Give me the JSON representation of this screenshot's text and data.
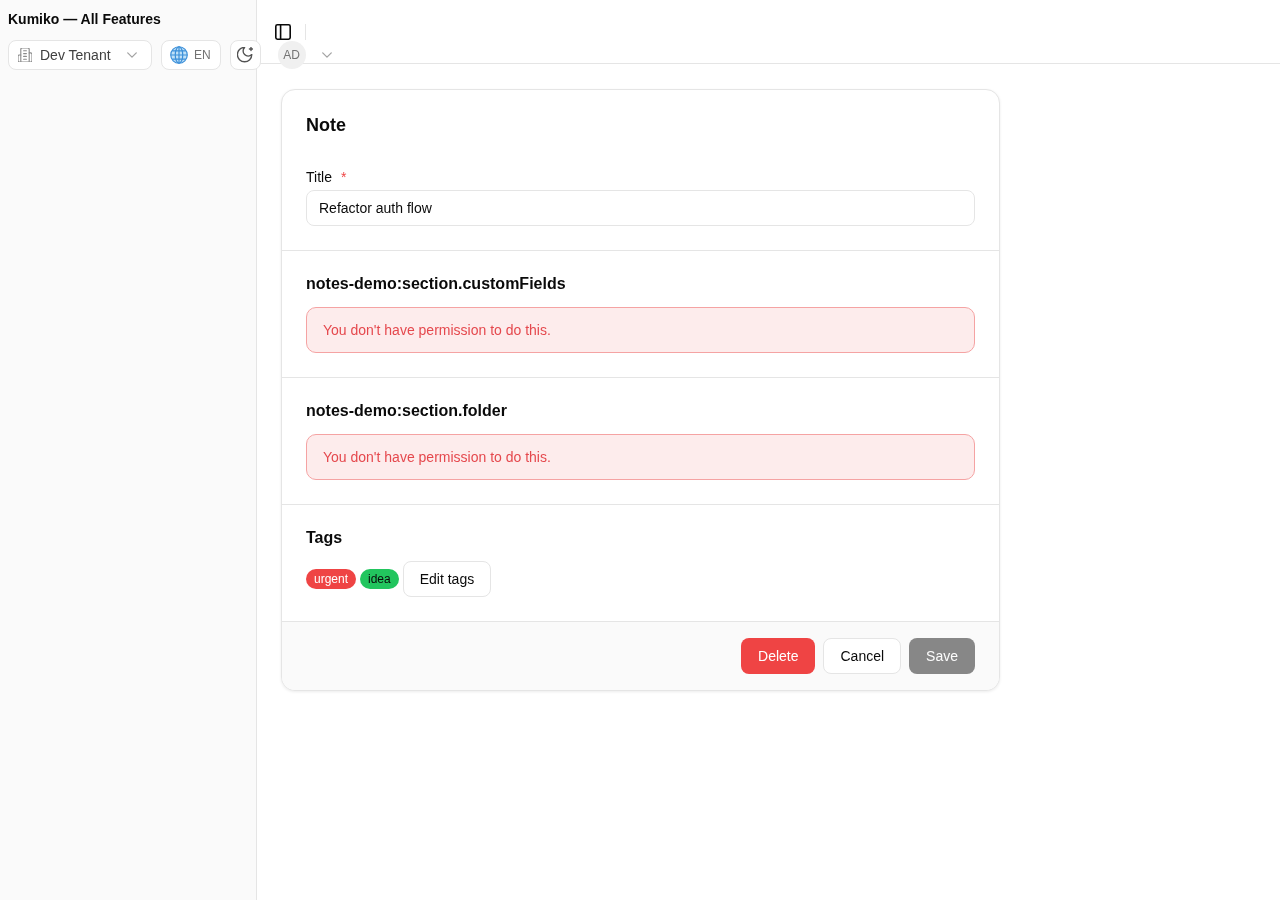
{
  "sidebar": {
    "title": "Kumiko — All Features",
    "tenant_select": {
      "value": "Dev Tenant"
    },
    "language_button": {
      "label": "EN"
    },
    "user_menu": {
      "initials": "AD"
    }
  },
  "card": {
    "title": "Note",
    "fields": [
      {
        "label": "Title",
        "required_mark": "*",
        "value": "Refactor auth flow"
      }
    ],
    "sections": [
      {
        "kind": "error",
        "heading": "notes-demo:section.customFields",
        "message": "You don't have permission to do this."
      },
      {
        "kind": "error",
        "heading": "notes-demo:section.folder",
        "message": "You don't have permission to do this."
      },
      {
        "kind": "tags",
        "heading": "Tags",
        "tags": [
          {
            "label": "urgent",
            "color": "#ef4444"
          },
          {
            "label": "idea",
            "color": "#22c55e"
          }
        ],
        "edit_button": "Edit tags"
      }
    ],
    "footer_buttons": [
      {
        "label": "Delete",
        "kind": "danger",
        "disabled": false
      },
      {
        "label": "Cancel",
        "kind": "outline",
        "disabled": false
      },
      {
        "label": "Save",
        "kind": "primary",
        "disabled": true
      }
    ]
  }
}
